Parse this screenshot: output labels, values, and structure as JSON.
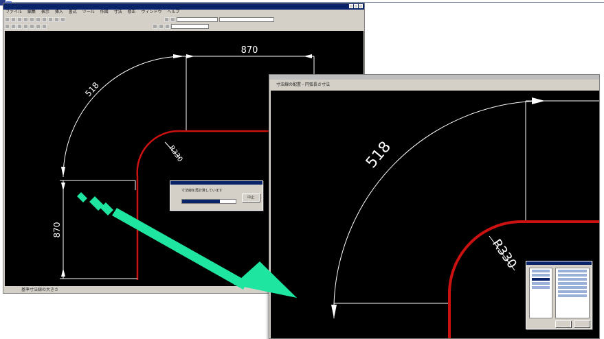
{
  "colors": {
    "canvas": "#000000",
    "geometry": "#ffffff",
    "profile": "#cc1111",
    "arrow": "#1ee6a0",
    "titlebar": "#0a246a"
  },
  "left_window": {
    "menu": [
      "ファイル",
      "編集",
      "表示",
      "挿入",
      "書式",
      "ツール",
      "作図",
      "寸法",
      "修正",
      "ウィンドウ",
      "ヘルプ"
    ],
    "status_text": "基準寸法線の大きさ",
    "dimensions": {
      "top_length": "870",
      "arc_length": "518",
      "radius": "R330",
      "vertical_length": "870"
    },
    "dialog": {
      "message": "寸法線を再計算しています",
      "button": "中止",
      "progress": 0.7
    }
  },
  "right_window": {
    "menu_text": "寸法線の配置 - 円弧長さ寸法",
    "dimensions": {
      "arc_length": "518",
      "radius": "R330"
    }
  },
  "arrow_icon": "big-diagonal-arrow-icon"
}
